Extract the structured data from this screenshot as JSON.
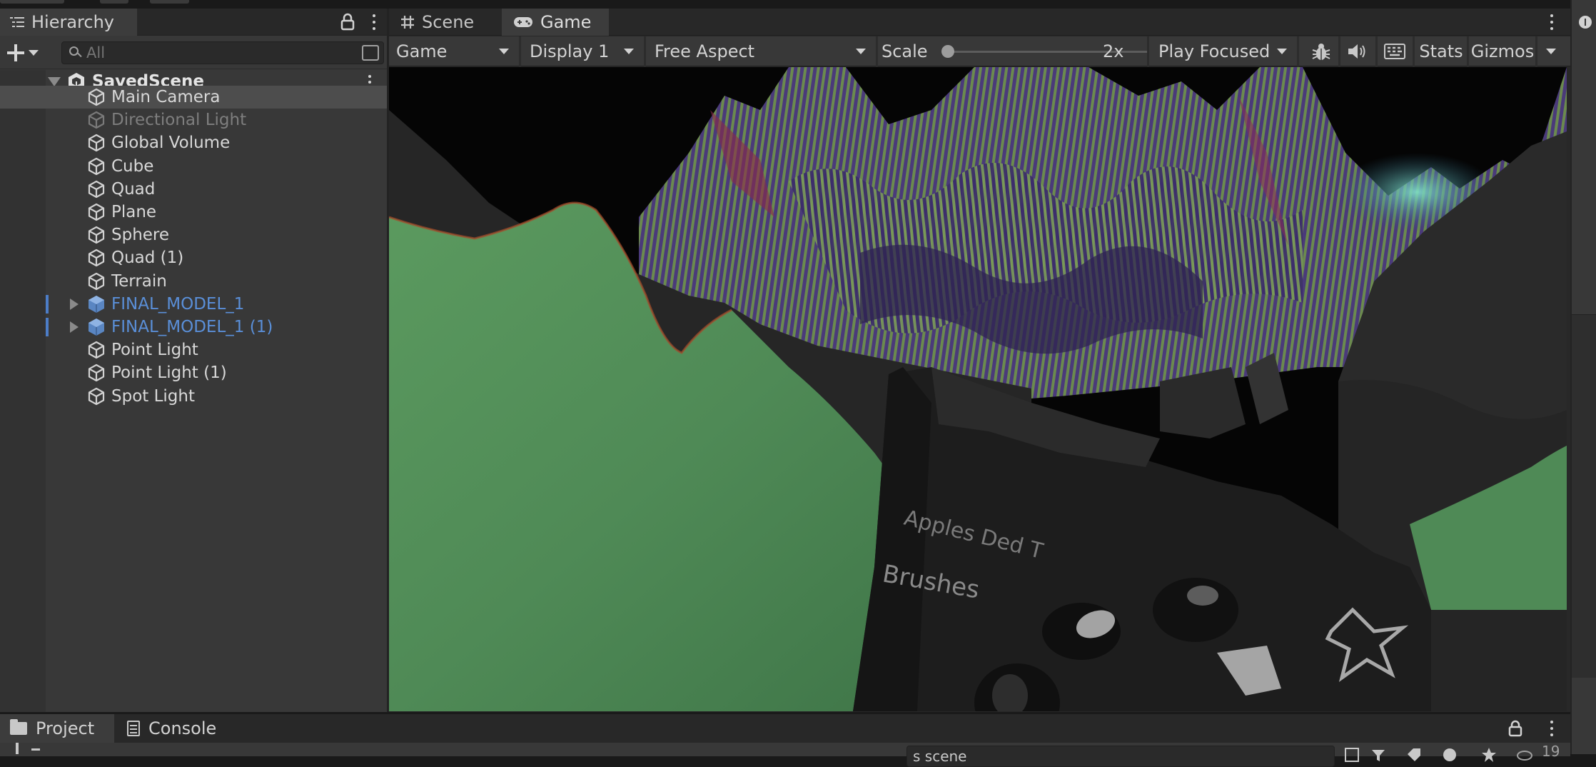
{
  "hierarchy": {
    "tab_label": "Hierarchy",
    "search_placeholder": "All",
    "scene_name": "SavedScene",
    "items": [
      {
        "label": "Main Camera",
        "selected": true,
        "disabled": false,
        "prefab": false,
        "expandable": false
      },
      {
        "label": "Directional Light",
        "selected": false,
        "disabled": true,
        "prefab": false,
        "expandable": false
      },
      {
        "label": "Global Volume",
        "selected": false,
        "disabled": false,
        "prefab": false,
        "expandable": false
      },
      {
        "label": "Cube",
        "selected": false,
        "disabled": false,
        "prefab": false,
        "expandable": false
      },
      {
        "label": "Quad",
        "selected": false,
        "disabled": false,
        "prefab": false,
        "expandable": false
      },
      {
        "label": "Plane",
        "selected": false,
        "disabled": false,
        "prefab": false,
        "expandable": false
      },
      {
        "label": "Sphere",
        "selected": false,
        "disabled": false,
        "prefab": false,
        "expandable": false
      },
      {
        "label": "Quad (1)",
        "selected": false,
        "disabled": false,
        "prefab": false,
        "expandable": false
      },
      {
        "label": "Terrain",
        "selected": false,
        "disabled": false,
        "prefab": false,
        "expandable": false
      },
      {
        "label": "FINAL_MODEL_1",
        "selected": false,
        "disabled": false,
        "prefab": true,
        "expandable": true
      },
      {
        "label": "FINAL_MODEL_1 (1)",
        "selected": false,
        "disabled": false,
        "prefab": true,
        "expandable": true
      },
      {
        "label": "Point Light",
        "selected": false,
        "disabled": false,
        "prefab": false,
        "expandable": false
      },
      {
        "label": "Point Light (1)",
        "selected": false,
        "disabled": false,
        "prefab": false,
        "expandable": false
      },
      {
        "label": "Spot Light",
        "selected": false,
        "disabled": false,
        "prefab": false,
        "expandable": false
      }
    ]
  },
  "game_panel": {
    "tabs": [
      {
        "label": "Scene",
        "icon": "grid-icon",
        "active": false
      },
      {
        "label": "Game",
        "icon": "gamepad-icon",
        "active": true
      }
    ],
    "toolbar": {
      "view_mode": "Game",
      "display": "Display 1",
      "aspect": "Free Aspect",
      "scale_label": "Scale",
      "scale_value": "2x",
      "scale_fraction": 0.0,
      "play_mode": "Play Focused",
      "stats_label": "Stats",
      "gizmos_label": "Gizmos",
      "icons": [
        "bug-icon",
        "audio-icon",
        "keyboard-icon"
      ]
    },
    "viewport_text": [
      "Apples Ded T",
      "Brushes"
    ]
  },
  "bottom_panel": {
    "tabs": [
      {
        "label": "Project",
        "icon": "folder-icon",
        "active": true
      },
      {
        "label": "Console",
        "icon": "console-icon",
        "active": false
      }
    ],
    "search_value": "s scene",
    "count": "19"
  },
  "colors": {
    "panel": "#383838",
    "tab_active": "#3c3c3c",
    "selection": "#4d4d4d",
    "prefab_text": "#5a8fd8",
    "terrain_green": "#4f8a56",
    "mountain_purple": "#5a3f8a"
  }
}
